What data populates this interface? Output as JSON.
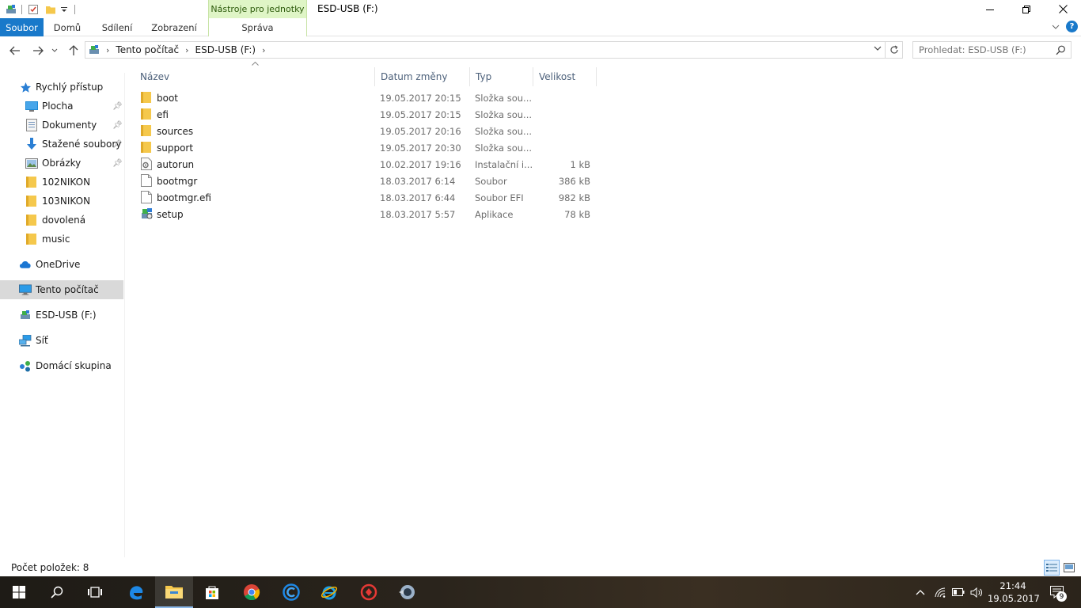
{
  "window": {
    "title": "ESD-USB (F:)",
    "context_tab_header": "Nástroje pro jednotky",
    "controls": {
      "minimize": "—",
      "restore": "❐",
      "close": "✕"
    }
  },
  "ribbon": {
    "tabs": [
      {
        "label": "Soubor"
      },
      {
        "label": "Domů"
      },
      {
        "label": "Sdílení"
      },
      {
        "label": "Zobrazení"
      },
      {
        "label": "Správa"
      }
    ],
    "help_label": "?"
  },
  "address_bar": {
    "breadcrumbs": [
      "Tento počítač",
      "ESD-USB (F:)"
    ]
  },
  "search": {
    "placeholder": "Prohledat: ESD-USB (F:)"
  },
  "sidebar": {
    "items": [
      {
        "label": "Rychlý přístup",
        "icon": "star-icon"
      },
      {
        "label": "Plocha",
        "icon": "desktop-icon",
        "pinned": true
      },
      {
        "label": "Dokumenty",
        "icon": "documents-icon",
        "pinned": true
      },
      {
        "label": "Stažené soubory",
        "icon": "download-icon",
        "pinned": true
      },
      {
        "label": "Obrázky",
        "icon": "pictures-icon",
        "pinned": true
      },
      {
        "label": "102NIKON",
        "icon": "folder-icon"
      },
      {
        "label": "103NIKON",
        "icon": "folder-icon"
      },
      {
        "label": "dovolená",
        "icon": "folder-icon"
      },
      {
        "label": "music",
        "icon": "folder-icon"
      },
      {
        "label": "OneDrive",
        "icon": "cloud-icon"
      },
      {
        "label": "Tento počítač",
        "icon": "computer-icon",
        "selected": true
      },
      {
        "label": "ESD-USB (F:)",
        "icon": "drive-icon"
      },
      {
        "label": "Síť",
        "icon": "network-icon"
      },
      {
        "label": "Domácí skupina",
        "icon": "homegroup-icon"
      }
    ]
  },
  "file_list": {
    "columns": {
      "name": "Název",
      "date": "Datum změny",
      "type": "Typ",
      "size": "Velikost"
    },
    "rows": [
      {
        "name": "boot",
        "date": "19.05.2017 20:15",
        "type": "Složka sou...",
        "size": "",
        "icon": "folder-icon"
      },
      {
        "name": "efi",
        "date": "19.05.2017 20:15",
        "type": "Složka sou...",
        "size": "",
        "icon": "folder-icon"
      },
      {
        "name": "sources",
        "date": "19.05.2017 20:16",
        "type": "Složka sou...",
        "size": "",
        "icon": "folder-icon"
      },
      {
        "name": "support",
        "date": "19.05.2017 20:30",
        "type": "Složka sou...",
        "size": "",
        "icon": "folder-icon"
      },
      {
        "name": "autorun",
        "date": "10.02.2017 19:16",
        "type": "Instalační i...",
        "size": "1 kB",
        "icon": "settings-file-icon"
      },
      {
        "name": "bootmgr",
        "date": "18.03.2017 6:14",
        "type": "Soubor",
        "size": "386 kB",
        "icon": "file-icon"
      },
      {
        "name": "bootmgr.efi",
        "date": "18.03.2017 6:44",
        "type": "Soubor EFI",
        "size": "982 kB",
        "icon": "file-icon"
      },
      {
        "name": "setup",
        "date": "18.03.2017 5:57",
        "type": "Aplikace",
        "size": "78 kB",
        "icon": "setup-app-icon"
      }
    ]
  },
  "status_bar": {
    "item_count": "Počet položek: 8"
  },
  "taskbar": {
    "clock_time": "21:44",
    "clock_date": "19.05.2017",
    "notification_count": "9"
  },
  "colors": {
    "accent": "#1979ca",
    "folder": "#f5c84c",
    "context_tab": "#dff5c6",
    "selection": "#d9d9d9"
  }
}
